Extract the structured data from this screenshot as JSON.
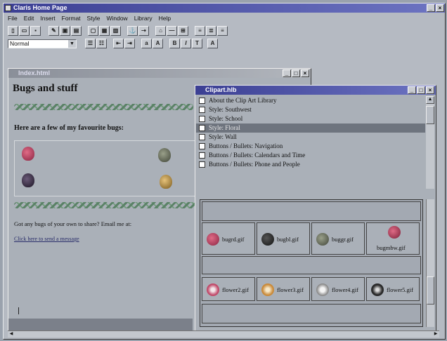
{
  "app": {
    "title": "Claris Home Page",
    "menu": [
      "File",
      "Edit",
      "Insert",
      "Format",
      "Style",
      "Window",
      "Library",
      "Help"
    ],
    "style_select": "Normal"
  },
  "editor": {
    "window_title": "Index.html",
    "heading": "Bugs and stuff",
    "subheading": "Here are a few of my favourite bugs:",
    "body_text": "Got any bugs of your own to share? Email me at:",
    "link_text": "Click here to send a message"
  },
  "library": {
    "window_title": "Clipart.hlb",
    "items": [
      "About the Clip Art Library",
      "Style: Southwest",
      "Style: School",
      "Style: Floral",
      "Style: Wall",
      "Buttons / Bullets: Navigation",
      "Buttons / Bullets: Calendars and Time",
      "Buttons / Bullets: Phone and People"
    ],
    "selected_index": 3,
    "thumbnails": [
      "bugrd.gif",
      "bugbl.gif",
      "buggr.gif",
      "bugmbw.gif",
      "flower2.gif",
      "flower3.gif",
      "flower4.gif",
      "flower5.gif"
    ]
  },
  "colors": {
    "title_bar": "#3b3f93",
    "selection": "#6e747e",
    "window_bg": "#aab0b8"
  }
}
